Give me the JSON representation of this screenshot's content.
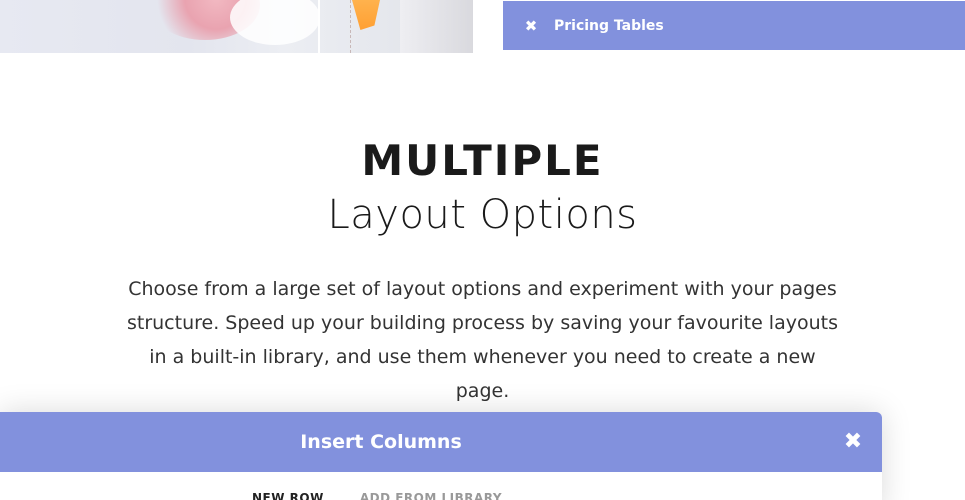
{
  "top_accordion": {
    "close_icon": "close-icon",
    "label": "Pricing Tables",
    "background_color": "#8291dd"
  },
  "section": {
    "heading_strong": "MULTIPLE",
    "heading_light": "Layout Options",
    "description": "Choose from a large set of layout options and experiment with your pages structure. Speed up your building process by saving your favourite layouts in a built-in library, and use them whenever you need to create a new page."
  },
  "modal": {
    "title": "Insert Columns",
    "close_icon": "close-icon",
    "header_color": "#8291dd",
    "tabs": [
      {
        "label": "NEW ROW",
        "active": true
      },
      {
        "label": "ADD FROM LIBRARY",
        "active": false
      }
    ]
  }
}
